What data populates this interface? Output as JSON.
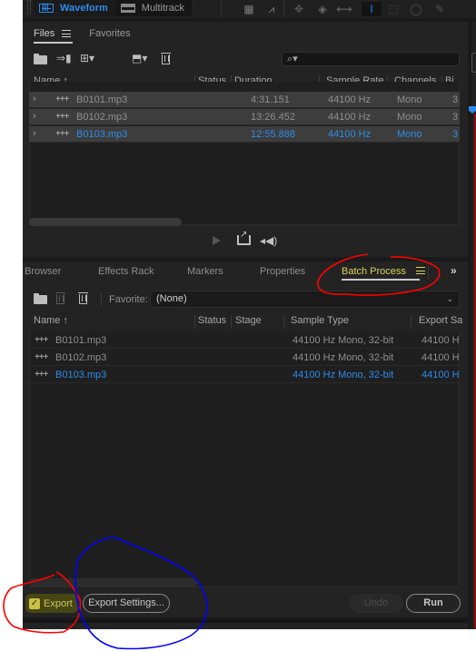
{
  "topbar": {
    "modes": [
      {
        "label": "Waveform",
        "icon": "waveform-icon",
        "active": true
      },
      {
        "label": "Multitrack",
        "icon": "multitrack-icon",
        "active": false
      }
    ],
    "tools": [
      "spectral-frequency-icon",
      "spectral-pitch-icon",
      "move-tool-icon",
      "razor-tool-icon",
      "slip-tool-icon",
      "time-selection-tool-icon",
      "marquee-tool-icon",
      "lasso-tool-icon",
      "brush-tool-icon"
    ],
    "active_tool": "time-selection-tool-icon"
  },
  "files_panel": {
    "tabs": [
      {
        "label": "Files",
        "active": true
      },
      {
        "label": "Favorites",
        "active": false
      }
    ],
    "menu_icon": "≡",
    "search_placeholder": "",
    "search_icon": "⌕▾",
    "columns": [
      "Name",
      "Status",
      "Duration",
      "Sample Rate",
      "Channels",
      "Bi"
    ],
    "sort_indicator": "↑",
    "rows": [
      {
        "name": "B0101.mp3",
        "status": "",
        "duration": "4:31.151",
        "sample_rate": "44100 Hz",
        "channels": "Mono",
        "bits": "3",
        "selected": false
      },
      {
        "name": "B0102.mp3",
        "status": "",
        "duration": "13:26.452",
        "sample_rate": "44100 Hz",
        "channels": "Mono",
        "bits": "3",
        "selected": false
      },
      {
        "name": "B0103.mp3",
        "status": "",
        "duration": "12:55.888",
        "sample_rate": "44100 Hz",
        "channels": "Mono",
        "bits": "3",
        "selected": true
      }
    ],
    "expand_glyph": "›",
    "wave_glyph": "+++"
  },
  "batch_panel": {
    "tabs": [
      {
        "label": "Browser",
        "active": false
      },
      {
        "label": "Effects Rack",
        "active": false
      },
      {
        "label": "Markers",
        "active": false
      },
      {
        "label": "Properties",
        "active": false
      },
      {
        "label": "Batch Process",
        "active": true
      }
    ],
    "more_glyph": "»",
    "favorite_label": "Favorite:",
    "favorite_value": "(None)",
    "columns": [
      "Name",
      "Status",
      "Stage",
      "Sample Type",
      "Export Sa"
    ],
    "rows": [
      {
        "name": "B0101.mp3",
        "status": "",
        "stage": "",
        "sample_type": "44100 Hz Mono, 32-bit",
        "export_sample": "44100 H",
        "selected": false
      },
      {
        "name": "B0102.mp3",
        "status": "",
        "stage": "",
        "sample_type": "44100 Hz Mono, 32-bit",
        "export_sample": "44100 H",
        "selected": false
      },
      {
        "name": "B0103.mp3",
        "status": "",
        "stage": "",
        "sample_type": "44100 Hz Mono, 32-bit",
        "export_sample": "44100 H",
        "selected": true
      }
    ],
    "footer": {
      "export_label": "Export",
      "export_checked": true,
      "export_settings_label": "Export Settings...",
      "undo_label": "Undo",
      "run_label": "Run"
    }
  },
  "colors": {
    "accent_blue": "#2d8ceb",
    "active_tab_yellow": "#d9d35a",
    "annotation_red": "#ff0000",
    "annotation_blue": "#0000ff"
  }
}
